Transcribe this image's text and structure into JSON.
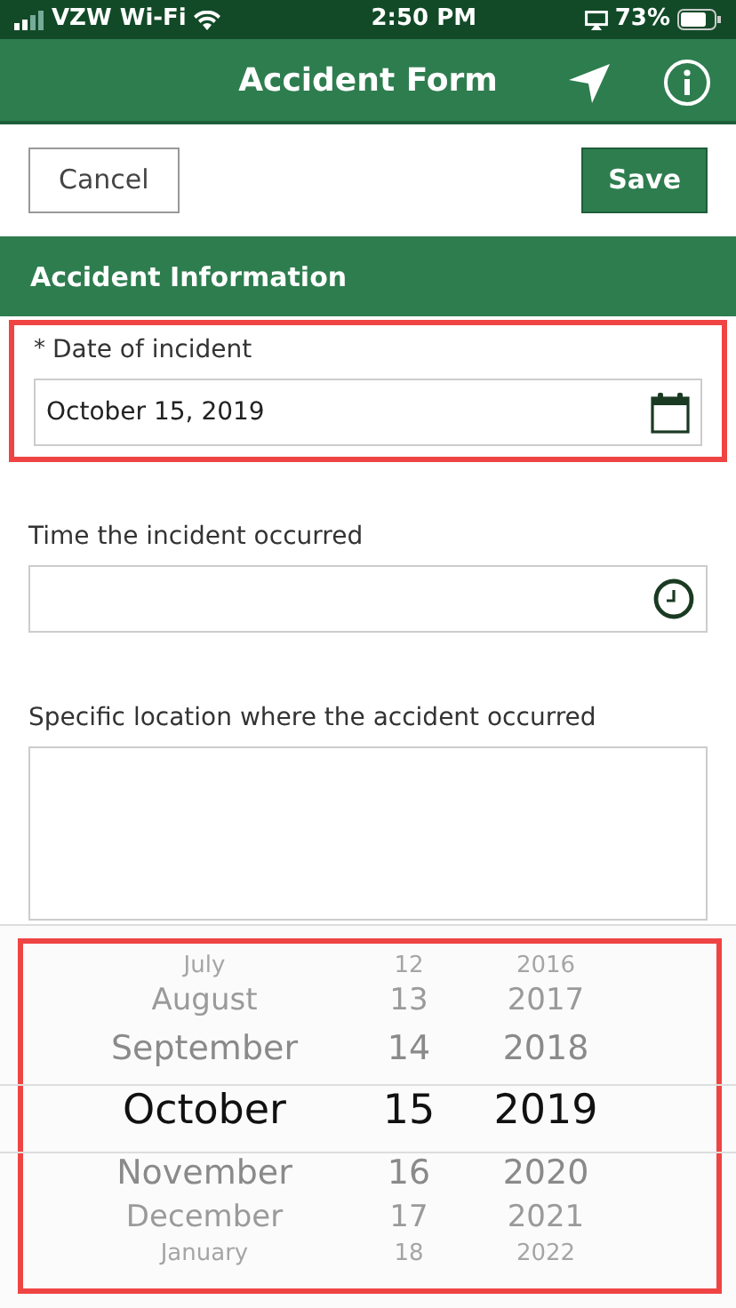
{
  "status_bar": {
    "carrier": "VZW Wi-Fi",
    "time": "2:50 PM",
    "battery": "73%"
  },
  "header": {
    "title": "Accident Form"
  },
  "toolbar": {
    "cancel": "Cancel",
    "save": "Save"
  },
  "section": {
    "title": "Accident Information"
  },
  "fields": [
    {
      "kind": "date",
      "required": true,
      "highlighted": true,
      "label": "Date of incident",
      "required_mark": "*",
      "value": "October 15, 2019"
    },
    {
      "kind": "time",
      "required": false,
      "highlighted": false,
      "label": "Time the incident occurred"
    },
    {
      "kind": "textarea",
      "required": false,
      "highlighted": false,
      "label": "Specific location where the accident occurred"
    }
  ],
  "picker": {
    "highlighted": true,
    "columns": [
      {
        "rows": [
          {
            "label": "July",
            "selected": false
          },
          {
            "label": "August",
            "selected": false
          },
          {
            "label": "September",
            "selected": false
          },
          {
            "label": "October",
            "selected": true
          },
          {
            "label": "November",
            "selected": false
          },
          {
            "label": "December",
            "selected": false
          },
          {
            "label": "January",
            "selected": false
          }
        ]
      },
      {
        "rows": [
          {
            "label": "12",
            "selected": false
          },
          {
            "label": "13",
            "selected": false
          },
          {
            "label": "14",
            "selected": false
          },
          {
            "label": "15",
            "selected": true
          },
          {
            "label": "16",
            "selected": false
          },
          {
            "label": "17",
            "selected": false
          },
          {
            "label": "18",
            "selected": false
          }
        ]
      },
      {
        "rows": [
          {
            "label": "2016",
            "selected": false
          },
          {
            "label": "2017",
            "selected": false
          },
          {
            "label": "2018",
            "selected": false
          },
          {
            "label": "2019",
            "selected": true
          },
          {
            "label": "2020",
            "selected": false
          },
          {
            "label": "2021",
            "selected": false
          },
          {
            "label": "2022",
            "selected": false
          }
        ]
      }
    ]
  }
}
